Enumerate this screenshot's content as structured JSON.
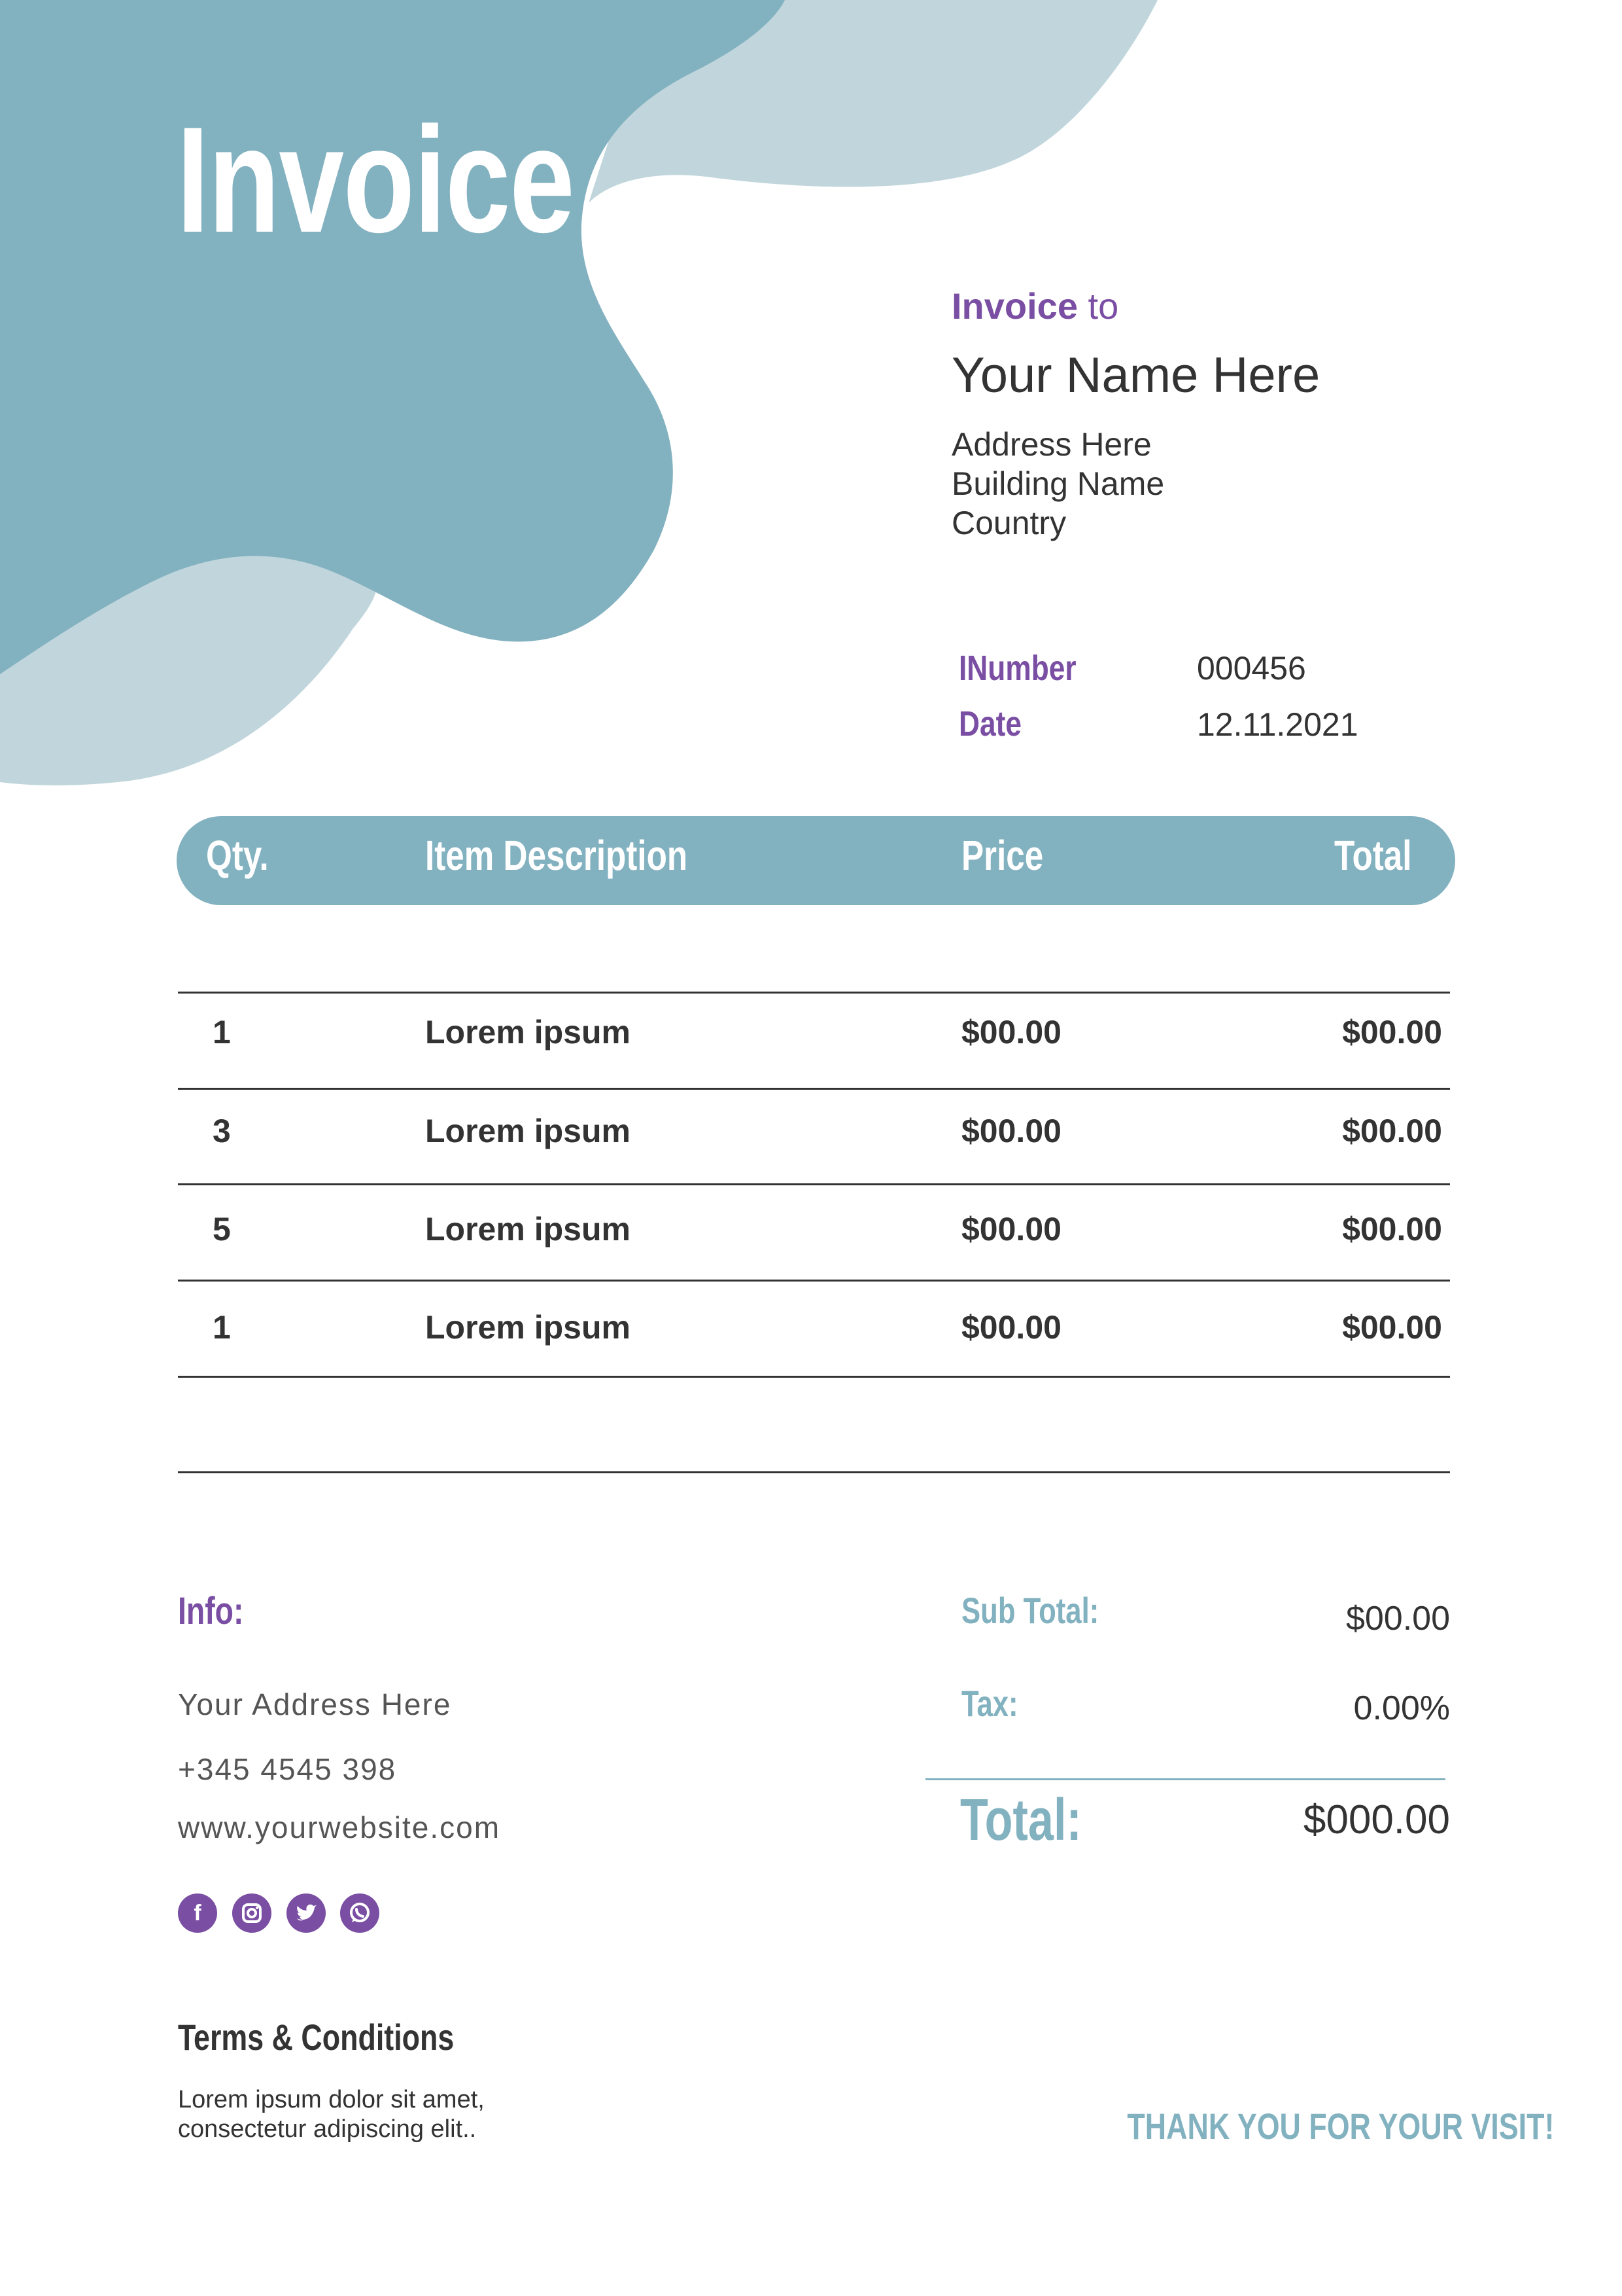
{
  "document": {
    "title": "Invoice",
    "accent_color": "#82b1c0",
    "accent_light_color": "#c1d6dc",
    "brand_color": "#7a4ea3"
  },
  "recipient": {
    "label_bold": "Invoice",
    "label_rest": " to",
    "name": "Your Name Here",
    "address_lines": [
      "Address Here",
      "Building Name",
      "Country"
    ]
  },
  "meta": {
    "number_label": "INumber",
    "number_value": "000456",
    "date_label": "Date",
    "date_value": "12.11.2021"
  },
  "table": {
    "headers": {
      "qty": "Qty.",
      "description": "Item Description",
      "price": "Price",
      "total": "Total"
    },
    "rows": [
      {
        "qty": "1",
        "description": "Lorem ipsum",
        "price": "$00.00",
        "total": "$00.00"
      },
      {
        "qty": "3",
        "description": "Lorem ipsum",
        "price": "$00.00",
        "total": "$00.00"
      },
      {
        "qty": "5",
        "description": "Lorem ipsum",
        "price": "$00.00",
        "total": "$00.00"
      },
      {
        "qty": "1",
        "description": "Lorem ipsum",
        "price": "$00.00",
        "total": "$00.00"
      }
    ]
  },
  "info": {
    "label": "Info:",
    "address": "Your Address Here",
    "phone": "+345 4545 398",
    "website": "www.yourwebsite.com",
    "social_icons": [
      "facebook-icon",
      "instagram-icon",
      "twitter-icon",
      "whatsapp-icon"
    ]
  },
  "summary": {
    "subtotal_label": "Sub Total:",
    "subtotal_value": "$00.00",
    "tax_label": "Tax:",
    "tax_value": "0.00%",
    "total_label": "Total:",
    "total_value": "$000.00"
  },
  "terms": {
    "title": "Terms & Conditions",
    "lines": [
      "Lorem ipsum dolor sit amet,",
      "consectetur adipiscing elit.."
    ]
  },
  "footer": {
    "thanks": "THANK YOU FOR YOUR VISIT!"
  }
}
